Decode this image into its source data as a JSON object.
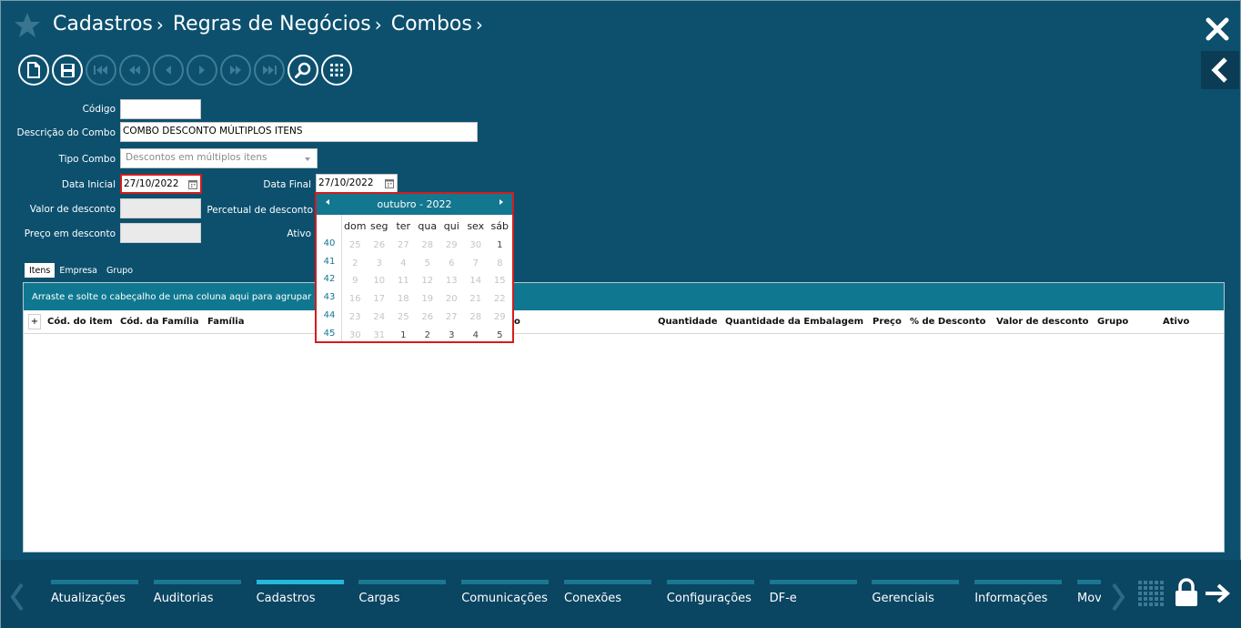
{
  "breadcrumb": [
    "Cadastros",
    "Regras de Negócios",
    "Combos"
  ],
  "toolbar": {
    "buttons": [
      "new-document-icon",
      "save-icon",
      "first-record-icon",
      "previous-page-icon",
      "previous-record-icon",
      "next-record-icon",
      "next-page-icon",
      "last-record-icon",
      "search-icon",
      "grid-view-icon"
    ]
  },
  "form": {
    "codigo_label": "Código",
    "codigo_value": "",
    "descricao_label": "Descrição do Combo",
    "descricao_value": "COMBO DESCONTO MÚLTIPLOS ITENS",
    "tipo_label": "Tipo Combo",
    "tipo_value": "Descontos em múltiplos itens",
    "data_inicial_label": "Data Inicial",
    "data_inicial_value": "27/10/2022",
    "data_final_label": "Data Final",
    "data_final_value": "27/10/2022",
    "valor_desconto_label": "Valor de desconto",
    "percentual_label": "Percetual de desconto",
    "preco_desconto_label": "Preço em desconto",
    "ativo_label": "Ativo"
  },
  "tabs": [
    "Itens",
    "Empresa",
    "Grupo"
  ],
  "grid": {
    "group_hint": "Arraste e solte o cabeçalho de uma coluna aqui para agrupar os dados",
    "plus": "+",
    "columns": [
      "Cód. do item",
      "Cód. da Família",
      "Família",
      "o",
      "Quantidade",
      "Quantidade da Embalagem",
      "Preço",
      "% de Desconto",
      "Valor de desconto",
      "Grupo",
      "Ativo"
    ]
  },
  "calendar": {
    "title": "outubro - 2022",
    "days_of_week": [
      "dom",
      "seg",
      "ter",
      "qua",
      "qui",
      "sex",
      "sáb"
    ],
    "weeks": [
      {
        "week": "40",
        "days": [
          "25",
          "26",
          "27",
          "28",
          "29",
          "30",
          "1"
        ]
      },
      {
        "week": "41",
        "days": [
          "2",
          "3",
          "4",
          "5",
          "6",
          "7",
          "8"
        ]
      },
      {
        "week": "42",
        "days": [
          "9",
          "10",
          "11",
          "12",
          "13",
          "14",
          "15"
        ]
      },
      {
        "week": "43",
        "days": [
          "16",
          "17",
          "18",
          "19",
          "20",
          "21",
          "22"
        ]
      },
      {
        "week": "44",
        "days": [
          "23",
          "24",
          "25",
          "26",
          "27",
          "28",
          "29"
        ]
      },
      {
        "week": "45",
        "days": [
          "30",
          "31",
          "1",
          "2",
          "3",
          "4",
          "5"
        ]
      }
    ],
    "selected_day": "27"
  },
  "bottom_nav": {
    "items": [
      "Atualizações",
      "Auditorias",
      "Cadastros",
      "Cargas",
      "Comunicações",
      "Conexões",
      "Configurações",
      "DF-e",
      "Gerenciais",
      "Informações",
      "Mov"
    ],
    "active": "Cadastros"
  },
  "colors": {
    "background": "#0c506e",
    "accent": "#13778f",
    "highlight_border": "#d21d1d",
    "active_tab_bar": "#23b8dc"
  }
}
